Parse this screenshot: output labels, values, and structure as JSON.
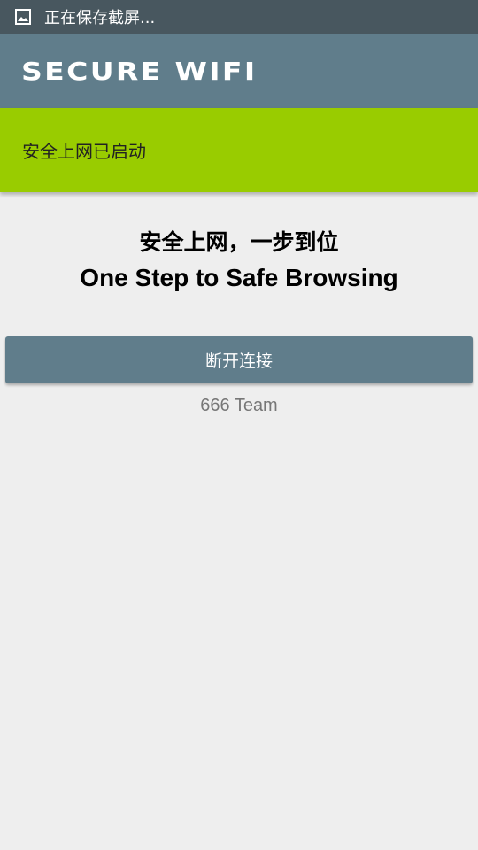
{
  "status_bar": {
    "icon": "screenshot-image-icon",
    "text": "正在保存截屏..."
  },
  "app_bar": {
    "title": "SECURE WIFI"
  },
  "banner": {
    "text": "安全上网已启动",
    "color": "#99cc00"
  },
  "headline": {
    "line1": "安全上网，一步到位",
    "line2": "One Step to Safe Browsing"
  },
  "button": {
    "label": "断开连接",
    "color": "#607d8b"
  },
  "footer": {
    "team": "666 Team"
  },
  "colors": {
    "status_bar": "#48575f",
    "app_bar": "#607d8b",
    "background": "#eeeeee"
  }
}
